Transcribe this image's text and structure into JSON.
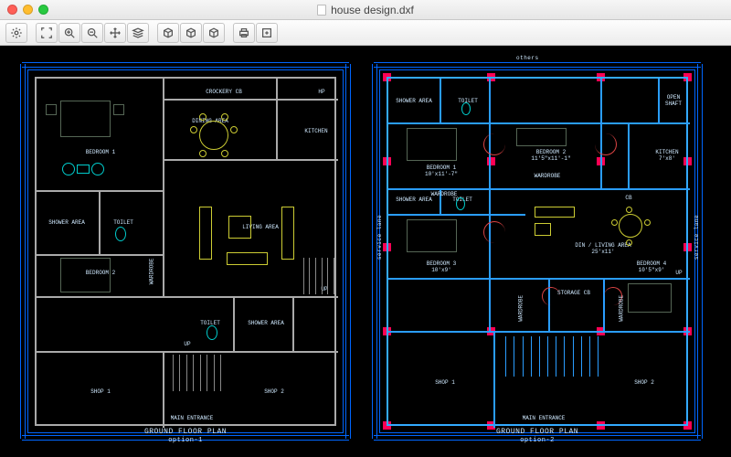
{
  "window": {
    "title": "house design.dxf"
  },
  "toolbar": {
    "settings": "Settings",
    "zoom_fit": "Zoom Fit",
    "zoom_in": "Zoom In",
    "zoom_out": "Zoom Out",
    "pan": "Pan",
    "layers": "Layers",
    "view_top": "Top View",
    "view_iso": "Iso View",
    "view_front": "Front View",
    "print": "Print",
    "export": "Export"
  },
  "plans": {
    "p1": {
      "title": "GROUND FLOOR PLAN",
      "subtitle": "option-1",
      "main_entrance": "MAIN ENTRANCE",
      "rooms": {
        "bedroom1": "BEDROOM 1",
        "bedroom2": "BEDROOM 2",
        "dining": "DINING AREA",
        "crockery": "CROCKERY CB",
        "kitchen": "KITCHEN",
        "living": "LIVING AREA",
        "toilet1": "TOILET",
        "toilet2": "TOILET",
        "shower": "SHOWER AREA",
        "shower2": "SHOWER AREA",
        "wardrobe": "WARDROBE",
        "shop1": "SHOP 1",
        "shop2": "SHOP 2",
        "up": "UP",
        "hp": "HP"
      }
    },
    "p2": {
      "title": "GROUND FLOOR PLAN",
      "subtitle": "option-2",
      "main_entrance": "MAIN ENTRANCE",
      "others": "others",
      "service_lane_l": "service lane",
      "service_lane_r": "service lane",
      "rooms": {
        "bedroom1": "BEDROOM 1\n10'x11'-7\"",
        "bedroom2": "BEDROOM 2\n11'5\"x11'-1\"",
        "bedroom3": "BEDROOM 3\n10'x9'",
        "bedroom4": "BEDROOM 4\n10'5\"x9'",
        "kitchen": "KITCHEN\n7'x8'",
        "dining": "DIN / LIVING AREA\n25'x11'",
        "toilet1": "TOILET",
        "toilet2": "TOILET",
        "shower1": "SHOWER AREA",
        "shower2": "SHOWER AREA",
        "wardrobe1": "WARDROBE",
        "wardrobe2": "WARDROBE",
        "wardrobe3": "WARDROBE",
        "wardrobe4": "WARDROBE",
        "storage": "STORAGE CB",
        "shop1": "SHOP 1",
        "shop2": "SHOP 2",
        "openshaft": "OPEN SHAFT",
        "cb": "CB",
        "up": "UP"
      }
    }
  }
}
